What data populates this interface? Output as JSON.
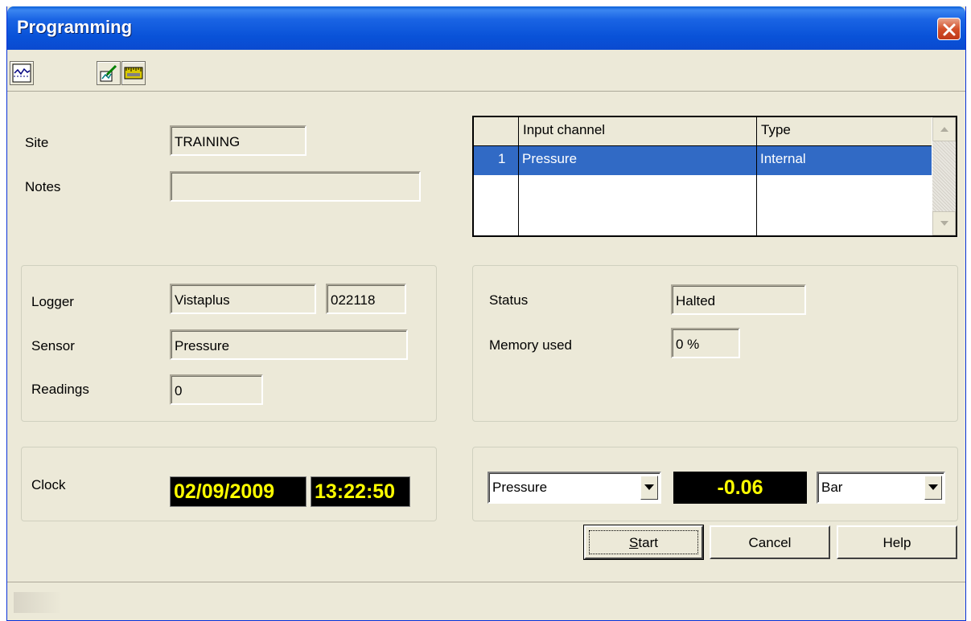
{
  "window": {
    "title": "Programming"
  },
  "toolbar": {
    "icons": [
      "chart-icon",
      "edit-chart-icon",
      "ruler-icon"
    ]
  },
  "site_panel": {
    "site_label": "Site",
    "site_value": "TRAINING",
    "notes_label": "Notes",
    "notes_value": ""
  },
  "channel_grid": {
    "headers": [
      "Input channel",
      "Type"
    ],
    "rows": [
      {
        "index": "1",
        "channel": "Pressure",
        "type": "Internal"
      }
    ]
  },
  "logger_panel": {
    "logger_label": "Logger",
    "logger_name": "Vistaplus",
    "logger_serial": "022118",
    "sensor_label": "Sensor",
    "sensor_value": "Pressure",
    "readings_label": "Readings",
    "readings_value": "0"
  },
  "status_panel": {
    "status_label": "Status",
    "status_value": "Halted",
    "memory_label": "Memory used",
    "memory_value": "0 %"
  },
  "clock_panel": {
    "clock_label": "Clock",
    "date": "02/09/2009",
    "time": "13:22:50"
  },
  "live_panel": {
    "channel_selected": "Pressure",
    "reading": "-0.06",
    "unit_selected": "Bar"
  },
  "buttons": {
    "start_prefix": "S",
    "start_rest": "tart",
    "cancel": "Cancel",
    "help": "Help"
  },
  "colors": {
    "titlebar": "#0a4ad0",
    "selection": "#316ac5",
    "display_text": "#ffff00",
    "display_bg": "#000000",
    "window_bg": "#ece9d8"
  }
}
